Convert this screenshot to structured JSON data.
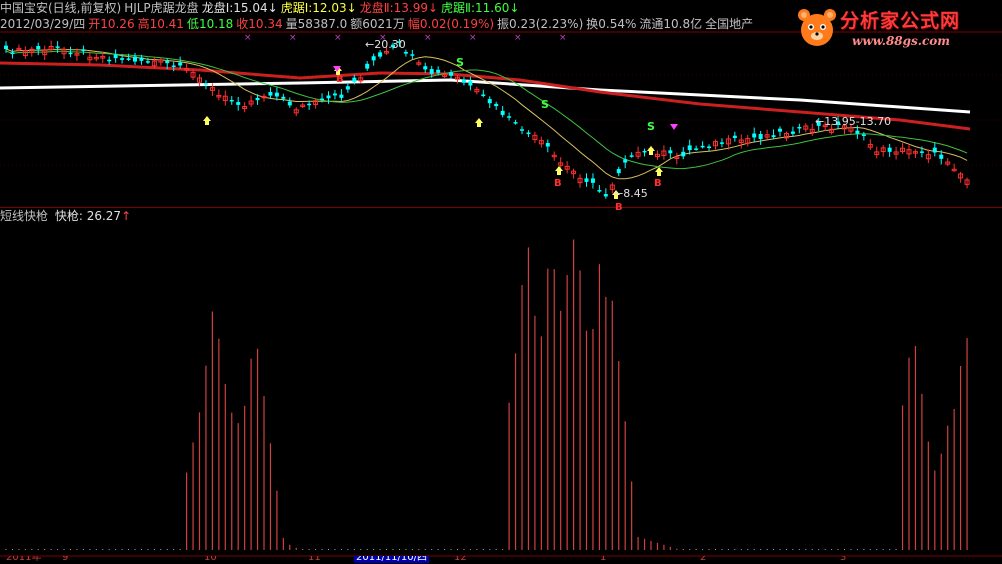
{
  "header": {
    "line1": [
      {
        "text": "中国宝安(日线,前复权)",
        "color": "#c0c0c0"
      },
      {
        "text": "HJLP虎踞龙盘",
        "color": "#c0c0c0"
      },
      {
        "text": "龙盘Ⅰ:15.04↓",
        "color": "#e0e0e0"
      },
      {
        "text": "虎踞Ⅰ:12.03↓",
        "color": "#ffff40"
      },
      {
        "text": "龙盘Ⅱ:13.99↓",
        "color": "#ff4040"
      },
      {
        "text": "虎踞Ⅱ:11.60↓",
        "color": "#40ff40"
      }
    ],
    "line2": [
      {
        "text": "2012/03/29/四",
        "color": "#c0c0c0"
      },
      {
        "text": "开10.26",
        "color": "#ff4040"
      },
      {
        "text": "高10.41",
        "color": "#ff4040"
      },
      {
        "text": "低10.18",
        "color": "#40ff40"
      },
      {
        "text": "收10.34",
        "color": "#ff4040"
      },
      {
        "text": "量58387.0",
        "color": "#c0c0c0"
      },
      {
        "text": "额6021万",
        "color": "#c0c0c0"
      },
      {
        "text": "幅0.02(0.19%)",
        "color": "#ff4040"
      },
      {
        "text": "振0.23(2.23%)",
        "color": "#c0c0c0"
      },
      {
        "text": "换0.54%",
        "color": "#c0c0c0"
      },
      {
        "text": "流通10.8亿",
        "color": "#c0c0c0"
      },
      {
        "text": "全国地产",
        "color": "#c0c0c0"
      }
    ]
  },
  "logo": {
    "title": "分析家公式网",
    "url": "www.88gs.com"
  },
  "subpanel": {
    "name": "短线快枪",
    "value_label": "快枪: 26.27",
    "arrow": "↑"
  },
  "annotations": {
    "high_price": "20.30",
    "low_price": "8.45",
    "range_label": "13.95-13.70",
    "sell_mark": "S",
    "buy_mark": "B"
  },
  "axis": {
    "labels": [
      "2011年",
      "9",
      "10",
      "11",
      "12",
      "1",
      "2",
      "3"
    ],
    "selected": "2011/11/10/四"
  },
  "colors": {
    "up": "#ff3030",
    "down": "#00ffff",
    "ma_white": "#ffffff",
    "ma_red": "#cc2020",
    "ma_yellow": "#d8c060",
    "ma_green": "#40c040",
    "histogram": "#d04040",
    "sell": "#40ff40",
    "buy": "#ff3030",
    "grid": "#800000"
  }
}
